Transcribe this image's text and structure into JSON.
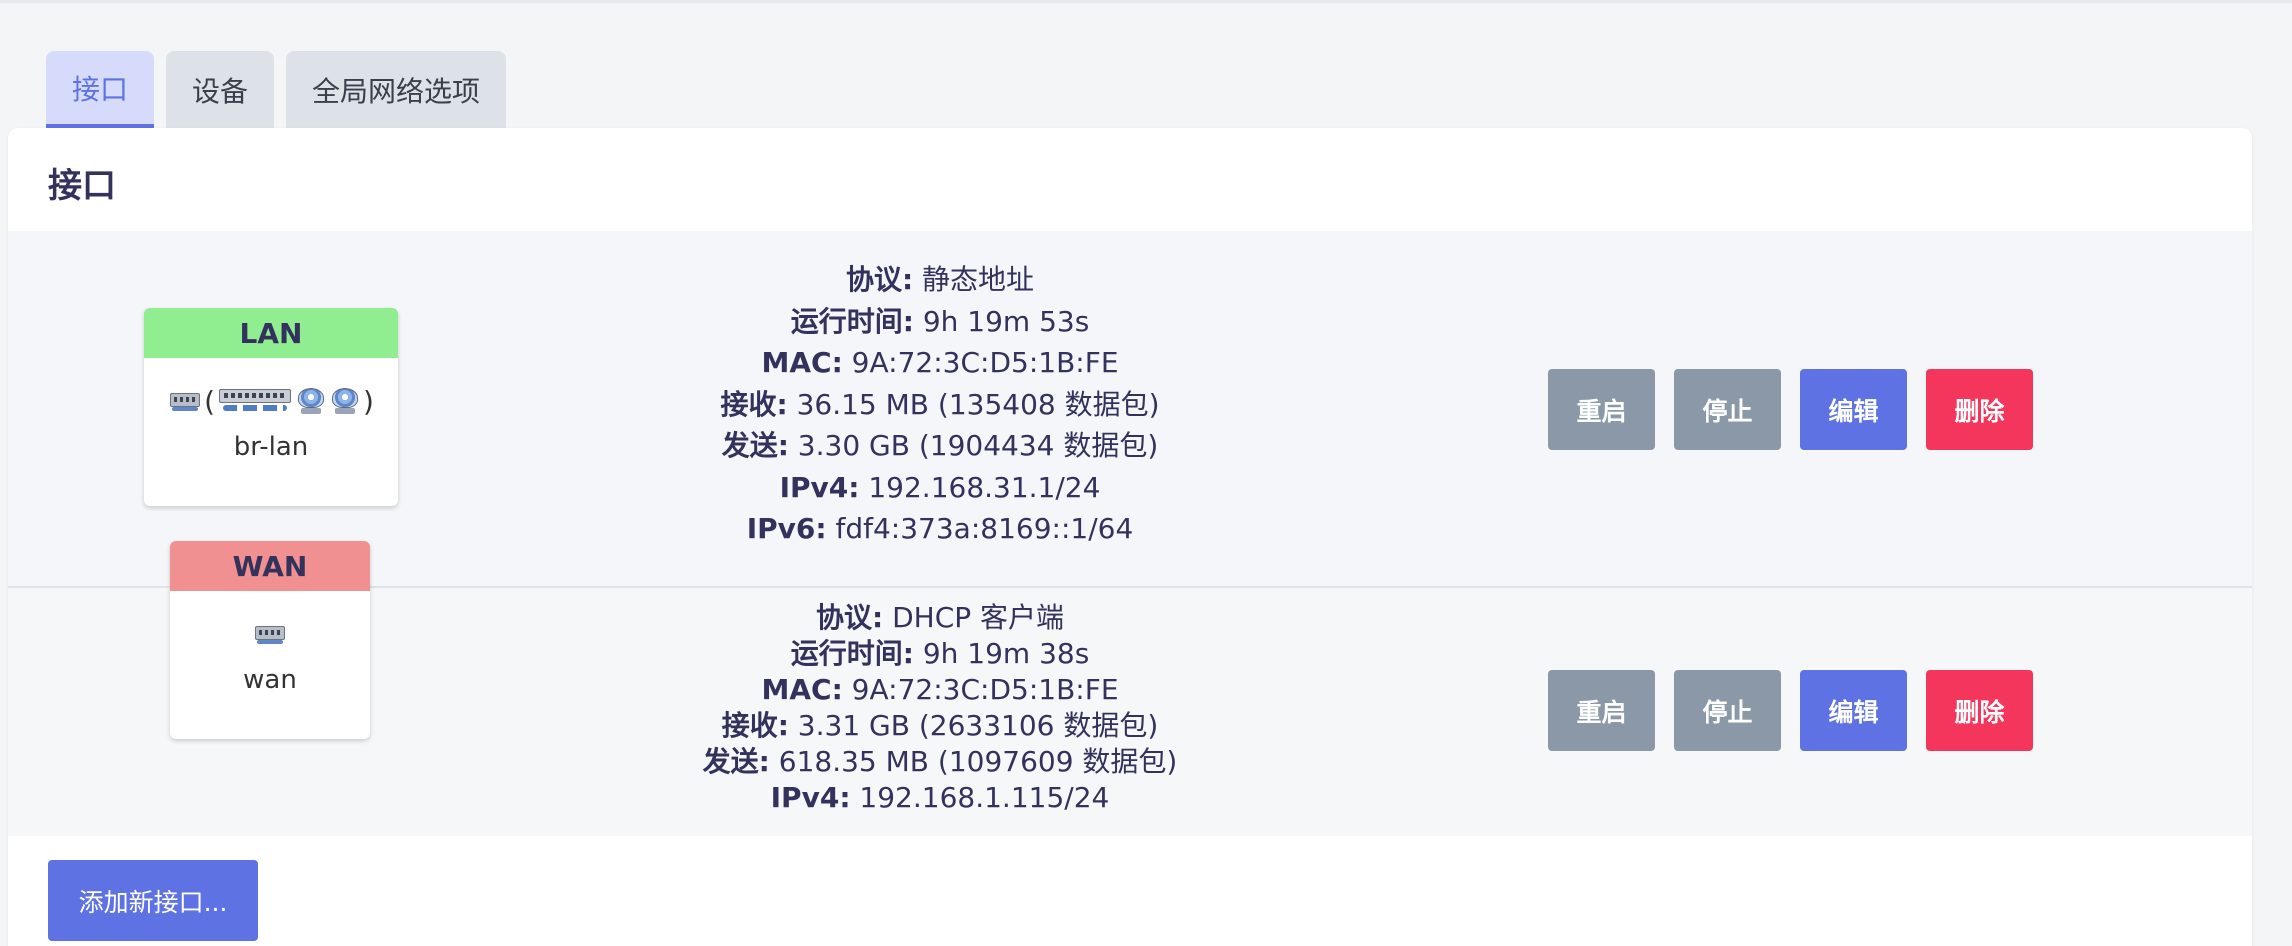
{
  "tabs": [
    {
      "label": "接口",
      "active": true
    },
    {
      "label": "设备",
      "active": false
    },
    {
      "label": "全局网络选项",
      "active": false
    }
  ],
  "card": {
    "title": "接口"
  },
  "interfaces": [
    {
      "name": "LAN",
      "header_color": "#90ee90",
      "device": "br-lan",
      "icons": [
        "ethernet-port-icon",
        "bridge-ports-icon",
        "wireless-icon",
        "wireless-icon"
      ],
      "details": [
        {
          "key": "协议:",
          "value": "静态地址"
        },
        {
          "key": "运行时间:",
          "value": "9h 19m 53s"
        },
        {
          "key": "MAC:",
          "value": "9A:72:3C:D5:1B:FE"
        },
        {
          "key": "接收:",
          "value": "36.15 MB (135408 数据包)"
        },
        {
          "key": "发送:",
          "value": "3.30 GB (1904434 数据包)"
        },
        {
          "key": "IPv4:",
          "value": "192.168.31.1/24"
        },
        {
          "key": "IPv6:",
          "value": "fdf4:373a:8169::1/64"
        }
      ]
    },
    {
      "name": "WAN",
      "header_color": "#f09090",
      "device": "wan",
      "icons": [
        "ethernet-port-icon"
      ],
      "details": [
        {
          "key": "协议:",
          "value": "DHCP 客户端"
        },
        {
          "key": "运行时间:",
          "value": "9h 19m 38s"
        },
        {
          "key": "MAC:",
          "value": "9A:72:3C:D5:1B:FE"
        },
        {
          "key": "接收:",
          "value": "3.31 GB (2633106 数据包)"
        },
        {
          "key": "发送:",
          "value": "618.35 MB (1097609 数据包)"
        },
        {
          "key": "IPv4:",
          "value": "192.168.1.115/24"
        }
      ]
    }
  ],
  "actions": {
    "restart": "重启",
    "stop": "停止",
    "edit": "编辑",
    "delete": "删除"
  },
  "add_interface": "添加新接口...",
  "colors": {
    "accent": "#5e72e4",
    "danger": "#f5365c",
    "neutral_button": "#8a98a8"
  }
}
